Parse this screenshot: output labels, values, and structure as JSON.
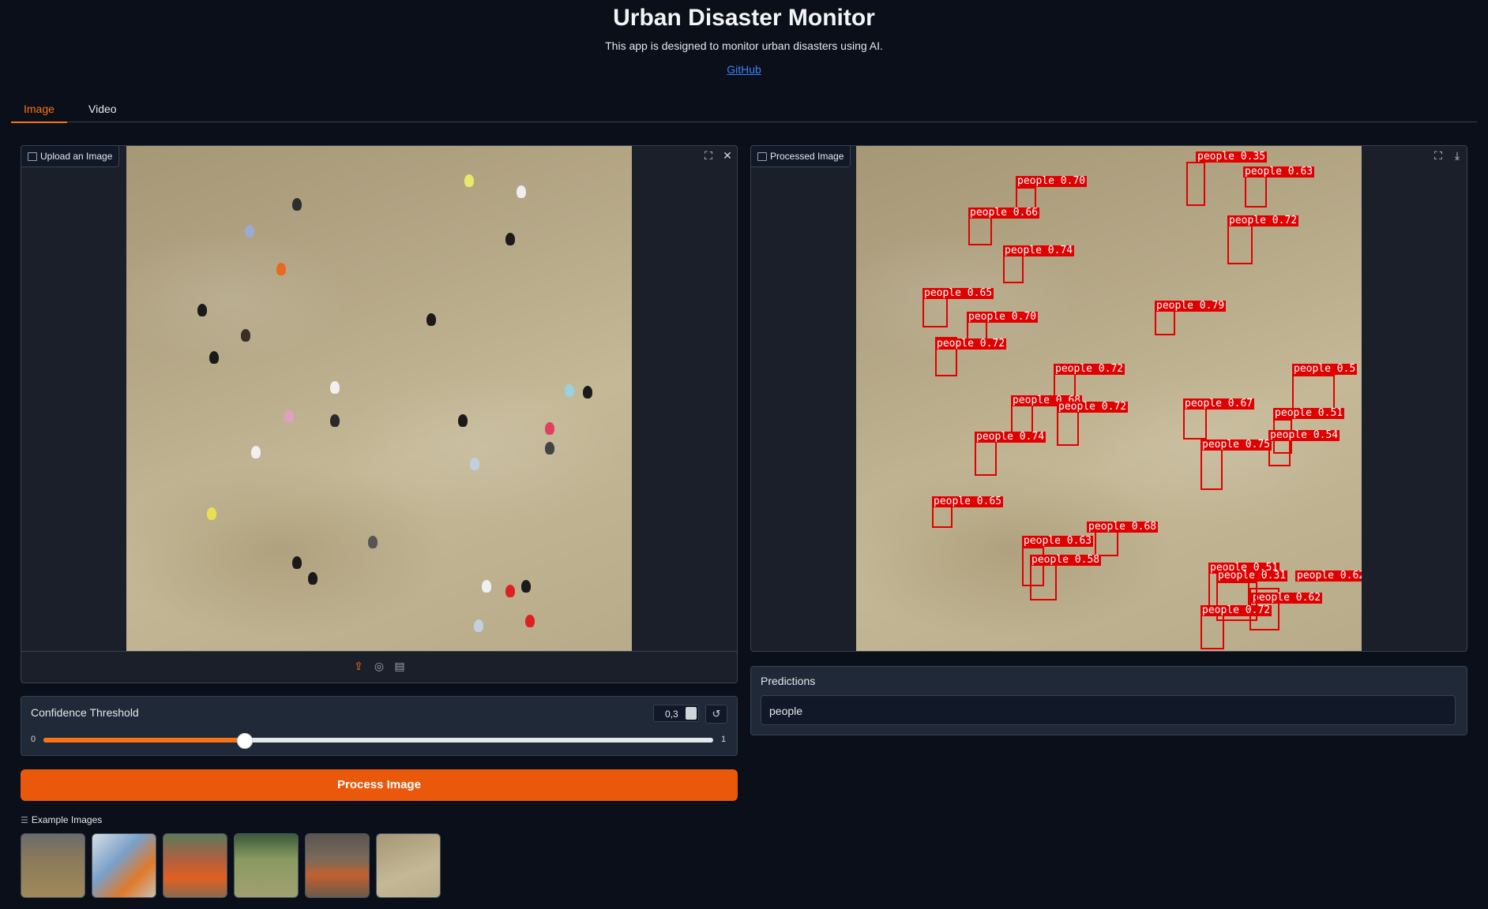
{
  "app": {
    "title": "Urban Disaster Monitor",
    "subtitle": "This app is designed to monitor urban disasters using AI.",
    "link_text": "GitHub"
  },
  "tabs": [
    {
      "label": "Image",
      "active": true
    },
    {
      "label": "Video",
      "active": false
    }
  ],
  "upload_panel": {
    "label": "Upload an Image",
    "icons": [
      "fullscreen-icon",
      "close-icon"
    ],
    "toolbar_icons": [
      "upload-icon",
      "webcam-icon",
      "clipboard-icon"
    ]
  },
  "processed_panel": {
    "label": "Processed Image",
    "icons": [
      "fullscreen-icon",
      "download-icon"
    ],
    "detections": [
      "people 0.35",
      "people 0.63",
      "people 0.70",
      "people 0.66",
      "people 0.72",
      "people 0.74",
      "people 0.65",
      "people 0.79",
      "people 0.70",
      "people 0.72",
      "people 0.72",
      "people 0.5",
      "people 0.68",
      "people 0.72",
      "people 0.67",
      "people 0.51",
      "people 0.74",
      "people 0.54",
      "people 0.75",
      "people 0.65",
      "people 0.68",
      "people 0.63",
      "people 0.58",
      "people 0.51",
      "people 0.62",
      "people 0.31",
      "people 0.62",
      "people 0.72"
    ]
  },
  "confidence": {
    "label": "Confidence Threshold",
    "value_text": "0,3",
    "value": 0.3,
    "min": "0",
    "max": "1"
  },
  "process_button": "Process Image",
  "examples": {
    "title": "Example Images",
    "count": 6
  },
  "predictions": {
    "title": "Predictions",
    "value": "people"
  },
  "colors": {
    "accent": "#f97316",
    "button": "#ea580c",
    "background": "#0b0f19",
    "detection": "#e00000",
    "link": "#3b82f6"
  }
}
